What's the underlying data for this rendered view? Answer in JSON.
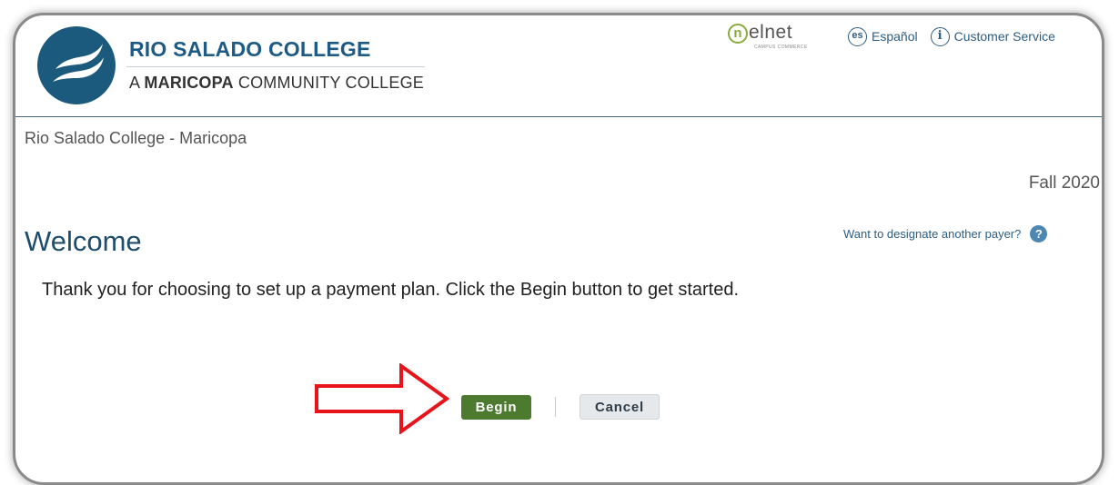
{
  "header": {
    "college_name": "RIO SALADO COLLEGE",
    "college_sub_prefix": "A ",
    "college_sub_bold": "MARICOPA",
    "college_sub_suffix": " COMMUNITY COLLEGE",
    "nelnet_logo": {
      "initial": "n",
      "word": "elnet",
      "tagline": "CAMPUS COMMERCE"
    },
    "language_icon_text": "es",
    "language_label": "Español",
    "info_icon_text": "i",
    "customer_service_label": "Customer Service"
  },
  "breadcrumb": "Rio Salado College - Maricopa",
  "term": "Fall 2020",
  "welcome": {
    "title": "Welcome",
    "payer_link": "Want to designate another payer?",
    "help_icon_text": "?",
    "intro": "Thank you for choosing to set up a payment plan. Click the Begin button to get started."
  },
  "actions": {
    "begin_label": "Begin",
    "cancel_label": "Cancel"
  },
  "colors": {
    "brand_blue": "#1d5a85",
    "begin_green": "#4c7a2e",
    "annotation_arrow_red": "#e8141b",
    "nelnet_green": "#8aab3d"
  },
  "icons": {
    "college_logo": "wave-logo-icon",
    "language": "es-circle-icon",
    "info": "info-circle-icon",
    "help": "question-circle-icon",
    "annotation": "right-arrow-icon"
  }
}
